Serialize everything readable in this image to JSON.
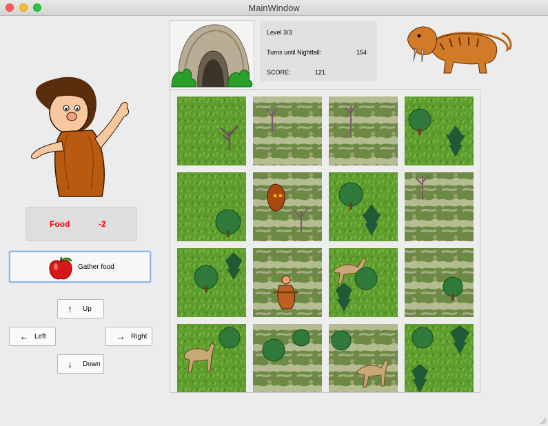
{
  "window": {
    "title": "MainWindow"
  },
  "player": {
    "food_label": "Food",
    "food_value": "-2"
  },
  "actions": {
    "gather_label": "Gather food",
    "up_label": "Up",
    "down_label": "Down",
    "left_label": "Left",
    "right_label": "Right"
  },
  "status": {
    "level": "Level 3/3",
    "turns_label": "Turns until Nightfall:",
    "turns_value": "154",
    "score_label": "SCORE:",
    "score_value": "121"
  },
  "colors": {
    "food_text": "#ff0000",
    "grass": "#5a9a2c",
    "focus_border": "#8fb6e8"
  },
  "icons": {
    "caveman": "caveman-icon",
    "cave": "cave-icon",
    "tiger": "sabertooth-tiger-icon",
    "apple": "apple-icon"
  },
  "board": {
    "rows": 4,
    "cols": 4,
    "tiles": [
      [
        "grass-dead-tree",
        "rocky-dead-tree",
        "rocky-dead-tree",
        "grass-trees"
      ],
      [
        "grass-tree",
        "rocky-stump-tree",
        "grass-trees",
        "rocky-dead-tree"
      ],
      [
        "grass-trees",
        "rocky-caveman",
        "grass-deer-trees",
        "rocky-tree"
      ],
      [
        "grass-deer-tree",
        "rocky-trees",
        "rocky-deer",
        "grass-trees"
      ]
    ]
  }
}
